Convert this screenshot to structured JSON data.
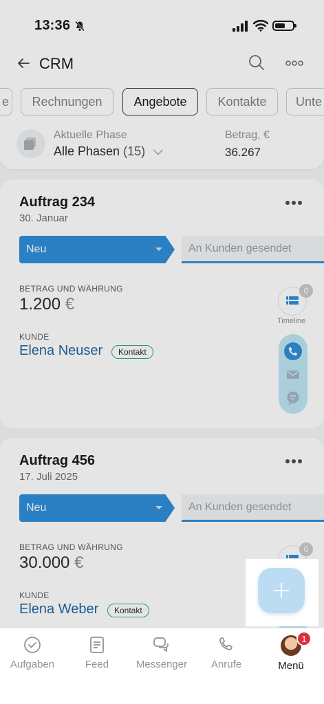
{
  "status_bar": {
    "time": "13:36"
  },
  "header": {
    "title": "CRM"
  },
  "tabs": [
    {
      "label": "e"
    },
    {
      "label": "Rechnungen"
    },
    {
      "label": "Angebote"
    },
    {
      "label": "Kontakte"
    },
    {
      "label": "Unte"
    }
  ],
  "summary": {
    "phase_label": "Aktuelle Phase",
    "phase_value": "Alle Phasen",
    "phase_count": "(15)",
    "amount_label": "Betrag, €",
    "amount_value": "36.267"
  },
  "deals": [
    {
      "title": "Auftrag 234",
      "date": "30. Januar",
      "stage": "Neu",
      "next_stage": "An Kunden gesendet",
      "amount_label": "BETRAG UND WÄHRUNG",
      "amount": "1.200",
      "currency": "€",
      "client_label": "KUNDE",
      "client_name": "Elena Neuser",
      "client_type": "Kontakt",
      "timeline_count": "0",
      "timeline_label": "Timeline"
    },
    {
      "title": "Auftrag 456",
      "date": "17. Juli 2025",
      "stage": "Neu",
      "next_stage": "An Kunden gesendet",
      "amount_label": "BETRAG UND WÄHRUNG",
      "amount": "30.000",
      "currency": "€",
      "client_label": "KUNDE",
      "client_name": "Elena Weber",
      "client_type": "Kontakt",
      "timeline_count": "0"
    }
  ],
  "bottom_nav": [
    {
      "label": "Aufgaben",
      "icon": "check-circle-icon"
    },
    {
      "label": "Feed",
      "icon": "feed-icon"
    },
    {
      "label": "Messenger",
      "icon": "chat-icon"
    },
    {
      "label": "Anrufe",
      "icon": "phone-icon"
    },
    {
      "label": "Menü",
      "icon": "avatar",
      "badge": "1"
    }
  ],
  "colors": {
    "accent": "#2f8fd8",
    "badge": "#e02b3b",
    "link": "#2068a8"
  }
}
